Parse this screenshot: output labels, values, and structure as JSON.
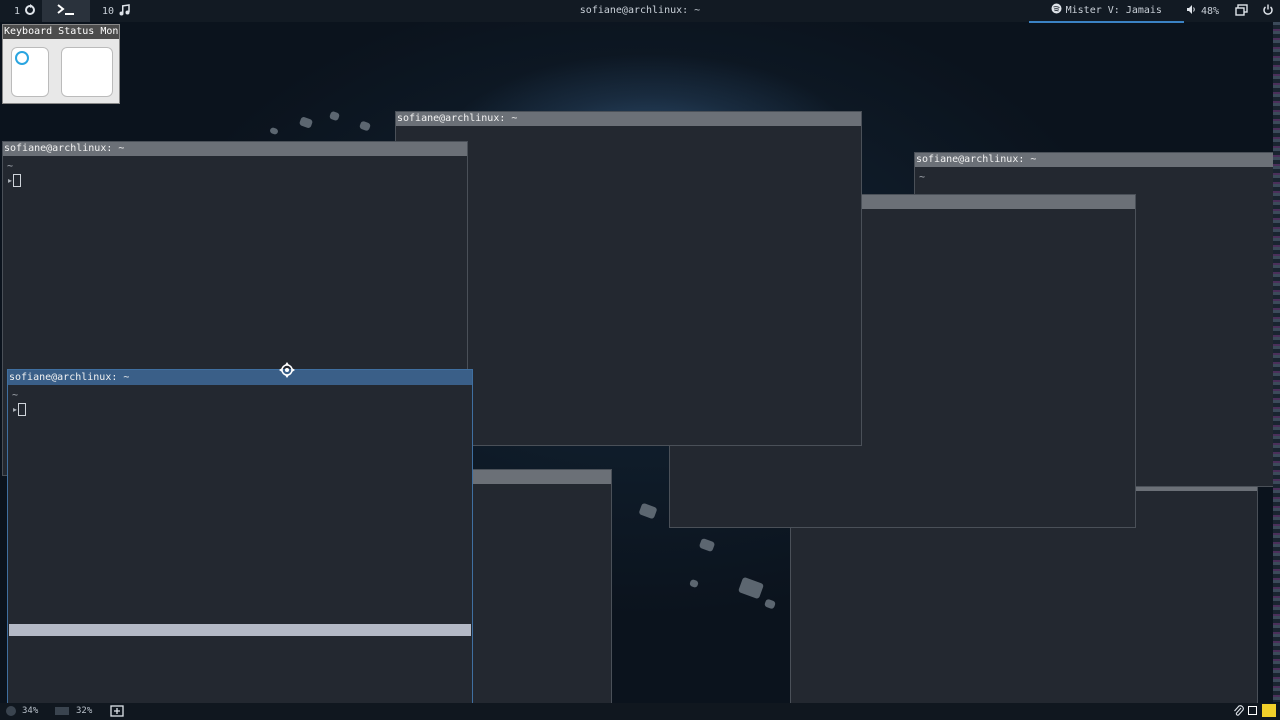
{
  "topbar": {
    "workspace1": "1",
    "workspace10": "10",
    "window_title": "sofiane@archlinux: ~",
    "now_playing": "Mister V: Jamais",
    "volume": "48%"
  },
  "keyboard_monitor": {
    "title": "Keyboard Status Monit"
  },
  "windows": {
    "w1_title": "sofiane@archlinux: ~",
    "w2_title": "sofiane@archlinux: ~",
    "w3_title": "sofiane@archlinux: ~",
    "w4_title": "sofiane@archlinux: ~",
    "prompt_dir": "~",
    "prompt_symbol": "▸"
  },
  "bottombar": {
    "cpu": "34%",
    "mem": "32%"
  },
  "colors": {
    "titlebar_inactive": "#6b7077",
    "titlebar_focused": "#3a5f88",
    "terminal_bg": "#232830",
    "accent": "#3b82c4"
  },
  "icons": [
    "refresh-icon",
    "terminal-icon",
    "music-note-icon",
    "spotify-icon",
    "volume-icon",
    "windows-icon",
    "power-icon",
    "cpu-icon",
    "memory-icon",
    "add-window-icon",
    "clip-icon",
    "square-icon"
  ]
}
